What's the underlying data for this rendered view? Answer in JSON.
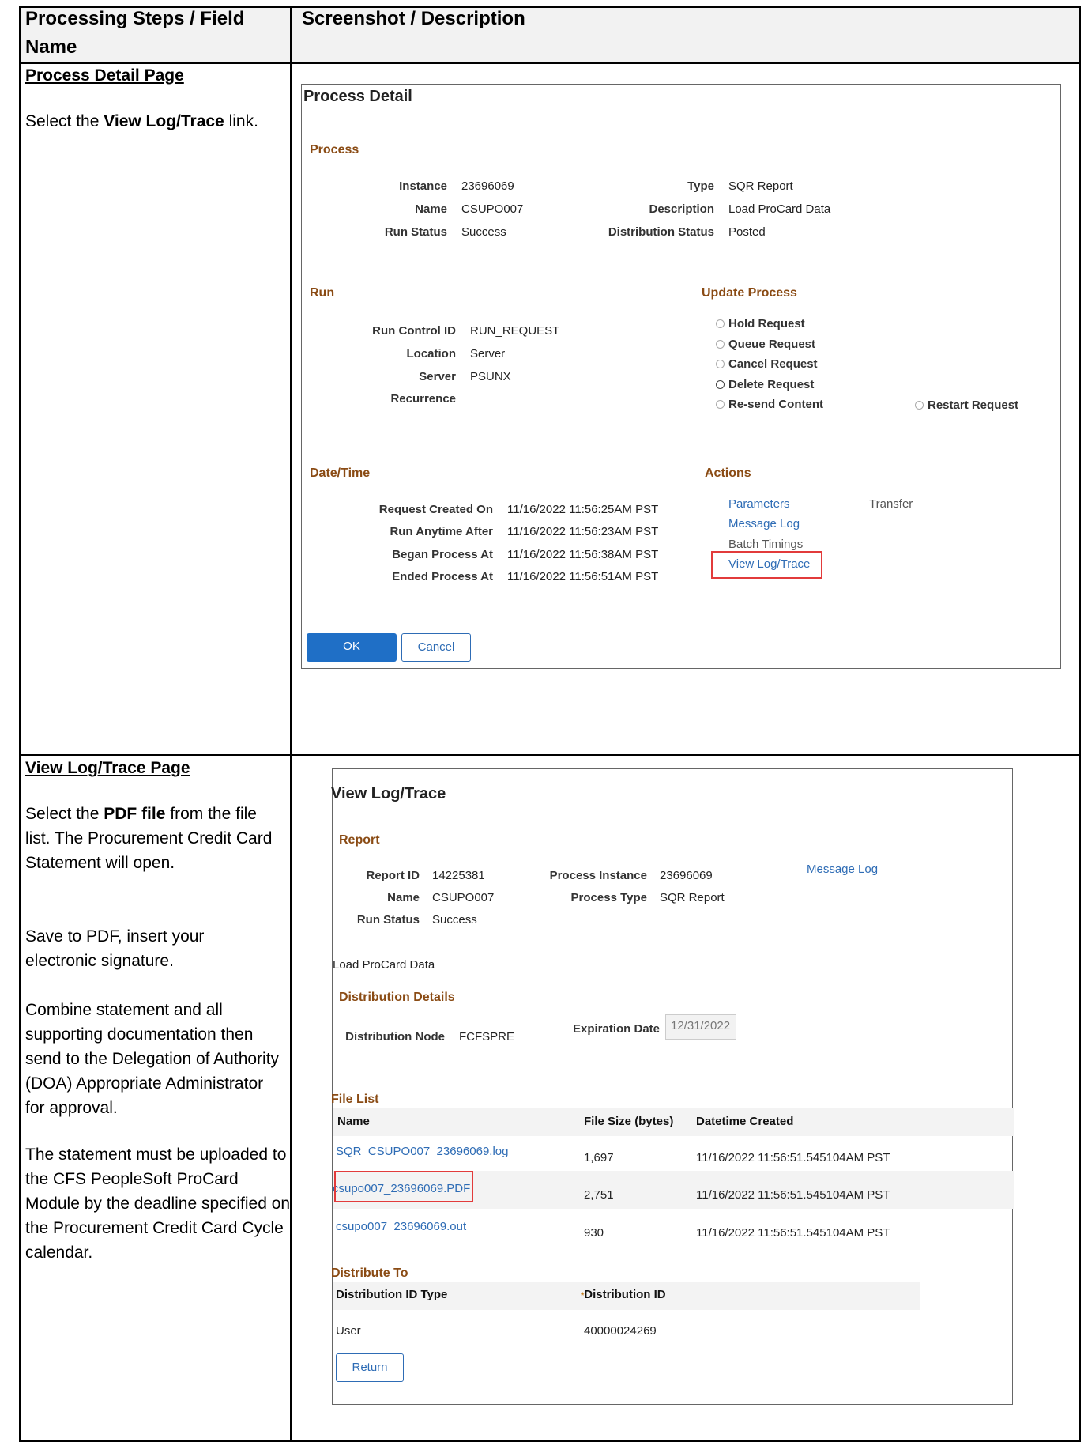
{
  "table": {
    "col1_header": "Processing Steps / Field Name",
    "col2_header": "Screenshot / Description"
  },
  "rows": [
    {
      "title": "Process Detail Page",
      "paragraphs": [
        {
          "before": "Select the ",
          "bold": "View Log/Trace",
          "after": " link."
        }
      ]
    },
    {
      "title": "View Log/Trace Page",
      "paragraphs": [
        {
          "before": "Select the ",
          "bold": "PDF file",
          "after": " from the file list. The Procurement Credit Card Statement will open."
        },
        {
          "before": "Save to PDF, insert your electronic signature.",
          "bold": "",
          "after": ""
        },
        {
          "before": "Combine statement and all supporting documentation then send to the Delegation of Authority (DOA) Appropriate Administrator for approval.",
          "bold": "",
          "after": ""
        },
        {
          "before": "The statement must be uploaded to the CFS PeopleSoft ProCard Module by the deadline specified on the Procurement Credit Card Cycle calendar.",
          "bold": "",
          "after": ""
        }
      ]
    }
  ],
  "process_detail": {
    "title": "Process Detail",
    "process_section": "Process",
    "instance_label": "Instance",
    "instance": "23696069",
    "name_label": "Name",
    "name": "CSUPO007",
    "run_status_label": "Run Status",
    "run_status": "Success",
    "type_label": "Type",
    "type": "SQR Report",
    "description_label": "Description",
    "description": "Load ProCard Data",
    "dist_status_label": "Distribution Status",
    "dist_status": "Posted",
    "run_section": "Run",
    "run_control_label": "Run Control ID",
    "run_control": "RUN_REQUEST",
    "location_label": "Location",
    "location": "Server",
    "server_label": "Server",
    "server": "PSUNX",
    "recurrence_label": "Recurrence",
    "update_section": "Update Process",
    "update_options": [
      "Hold Request",
      "Queue Request",
      "Cancel Request",
      "Delete Request",
      "Re-send Content"
    ],
    "restart_option": "Restart Request",
    "datetime_section": "Date/Time",
    "req_created_label": "Request Created On",
    "req_created": "11/16/2022 11:56:25AM PST",
    "run_after_label": "Run Anytime After",
    "run_after": "11/16/2022 11:56:23AM PST",
    "began_label": "Began Process At",
    "began": "11/16/2022 11:56:38AM PST",
    "ended_label": "Ended Process At",
    "ended": "11/16/2022 11:56:51AM PST",
    "actions_section": "Actions",
    "parameters": "Parameters",
    "transfer": "Transfer",
    "message_log": "Message Log",
    "batch_timings": "Batch Timings",
    "view_log": "View Log/Trace",
    "ok": "OK",
    "cancel": "Cancel"
  },
  "log_trace": {
    "title": "View Log/Trace",
    "report_section": "Report",
    "report_id_label": "Report ID",
    "report_id": "14225381",
    "name_label": "Name",
    "name": "CSUPO007",
    "run_status_label": "Run Status",
    "run_status": "Success",
    "proc_instance_label": "Process Instance",
    "proc_instance": "23696069",
    "proc_type_label": "Process Type",
    "proc_type": "SQR Report",
    "message_log": "Message Log",
    "description": "Load ProCard Data",
    "dist_details_section": "Distribution Details",
    "dist_node_label": "Distribution Node",
    "dist_node": "FCFSPRE",
    "exp_date_label": "Expiration Date",
    "exp_date": "12/31/2022",
    "file_list_section": "File List",
    "file_headers": {
      "name": "Name",
      "size": "File Size (bytes)",
      "created": "Datetime Created"
    },
    "files": [
      {
        "name": "SQR_CSUPO007_23696069.log",
        "size": "1,697",
        "created": "11/16/2022 11:56:51.545104AM PST"
      },
      {
        "name": "csupo007_23696069.PDF",
        "size": "2,751",
        "created": "11/16/2022 11:56:51.545104AM PST"
      },
      {
        "name": "csupo007_23696069.out",
        "size": "930",
        "created": "11/16/2022 11:56:51.545104AM PST"
      }
    ],
    "distribute_to_section": "Distribute To",
    "dist_headers": {
      "type": "Distribution ID Type",
      "id": "Distribution ID",
      "id_marker": "*"
    },
    "dist_type": "User",
    "dist_id": "40000024269",
    "return": "Return"
  }
}
